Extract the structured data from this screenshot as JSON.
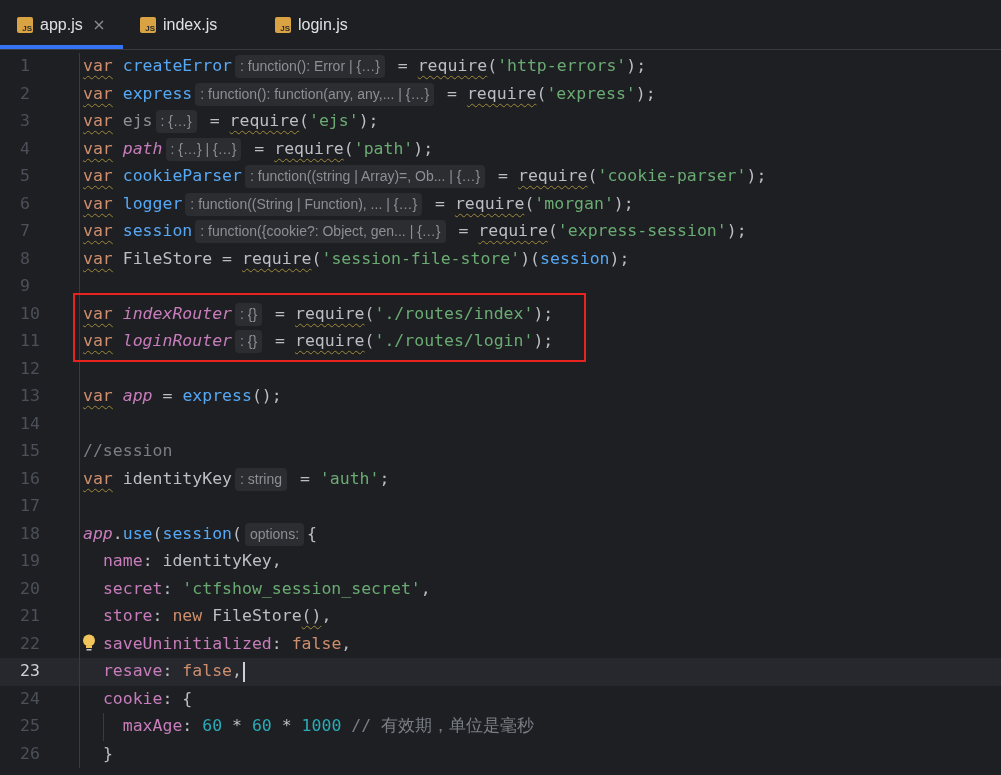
{
  "tabs": [
    {
      "label": "app.js",
      "icon": "JS",
      "selected": true,
      "closable": true
    },
    {
      "label": "index.js",
      "icon": "JS",
      "selected": false
    },
    {
      "label": "login.js",
      "icon": "JS",
      "selected": false
    }
  ],
  "lines": [
    {
      "number": "1",
      "tokens": [
        {
          "kind": "kw",
          "text": "var",
          "squiggle": true
        },
        {
          "kind": "fn",
          "text": " createError"
        },
        {
          "kind": "hint",
          "text": ": function(): Error | {…}"
        },
        {
          "kind": "plain",
          "text": " = "
        },
        {
          "kind": "plain",
          "text": "require",
          "squiggle": true
        },
        {
          "kind": "plain",
          "text": "("
        },
        {
          "kind": "str",
          "text": "'http-errors'"
        },
        {
          "kind": "plain",
          "text": ");"
        }
      ]
    },
    {
      "number": "2",
      "tokens": [
        {
          "kind": "kw",
          "text": "var",
          "squiggle": true
        },
        {
          "kind": "fn",
          "text": " express"
        },
        {
          "kind": "hint",
          "text": ": function(): function(any, any,... | {…}"
        },
        {
          "kind": "plain",
          "text": " = "
        },
        {
          "kind": "plain",
          "text": "require",
          "squiggle": true
        },
        {
          "kind": "plain",
          "text": "("
        },
        {
          "kind": "str",
          "text": "'express'"
        },
        {
          "kind": "plain",
          "text": ");"
        }
      ]
    },
    {
      "number": "3",
      "tokens": [
        {
          "kind": "kw",
          "text": "var",
          "squiggle": true
        },
        {
          "kind": "dim",
          "text": " ejs"
        },
        {
          "kind": "hint",
          "text": ": {…}"
        },
        {
          "kind": "plain",
          "text": " = "
        },
        {
          "kind": "plain",
          "text": "require",
          "squiggle": true
        },
        {
          "kind": "plain",
          "text": "("
        },
        {
          "kind": "str",
          "text": "'ejs'"
        },
        {
          "kind": "plain",
          "text": ");"
        }
      ]
    },
    {
      "number": "4",
      "tokens": [
        {
          "kind": "kw",
          "text": "var",
          "squiggle": true
        },
        {
          "kind": "param",
          "text": " path"
        },
        {
          "kind": "hint",
          "text": ": {…} | {…}"
        },
        {
          "kind": "plain",
          "text": " = "
        },
        {
          "kind": "plain",
          "text": "require",
          "squiggle": true
        },
        {
          "kind": "plain",
          "text": "("
        },
        {
          "kind": "str",
          "text": "'path'"
        },
        {
          "kind": "plain",
          "text": ");"
        }
      ]
    },
    {
      "number": "5",
      "tokens": [
        {
          "kind": "kw",
          "text": "var",
          "squiggle": true
        },
        {
          "kind": "fn",
          "text": " cookieParser"
        },
        {
          "kind": "hint",
          "text": ": function((string | Array)=, Ob... | {…}"
        },
        {
          "kind": "plain",
          "text": " = "
        },
        {
          "kind": "plain",
          "text": "require",
          "squiggle": true
        },
        {
          "kind": "plain",
          "text": "("
        },
        {
          "kind": "str",
          "text": "'cookie-parser'"
        },
        {
          "kind": "plain",
          "text": ");"
        }
      ]
    },
    {
      "number": "6",
      "tokens": [
        {
          "kind": "kw",
          "text": "var",
          "squiggle": true
        },
        {
          "kind": "fn",
          "text": " logger"
        },
        {
          "kind": "hint",
          "text": ": function((String | Function), ... | {…}"
        },
        {
          "kind": "plain",
          "text": " = "
        },
        {
          "kind": "plain",
          "text": "require",
          "squiggle": true
        },
        {
          "kind": "plain",
          "text": "("
        },
        {
          "kind": "str",
          "text": "'morgan'"
        },
        {
          "kind": "plain",
          "text": ");"
        }
      ]
    },
    {
      "number": "7",
      "tokens": [
        {
          "kind": "kw",
          "text": "var",
          "squiggle": true
        },
        {
          "kind": "fn",
          "text": " session"
        },
        {
          "kind": "hint",
          "text": ": function({cookie?: Object, gen... | {…}"
        },
        {
          "kind": "plain",
          "text": " = "
        },
        {
          "kind": "plain",
          "text": "require",
          "squiggle": true
        },
        {
          "kind": "plain",
          "text": "("
        },
        {
          "kind": "str",
          "text": "'express-session'"
        },
        {
          "kind": "plain",
          "text": ");"
        }
      ]
    },
    {
      "number": "8",
      "tokens": [
        {
          "kind": "kw",
          "text": "var",
          "squiggle": true
        },
        {
          "kind": "plain",
          "text": " FileStore = "
        },
        {
          "kind": "plain",
          "text": "require",
          "squiggle": true
        },
        {
          "kind": "plain",
          "text": "("
        },
        {
          "kind": "str",
          "text": "'session-file-store'"
        },
        {
          "kind": "plain",
          "text": ")("
        },
        {
          "kind": "fn",
          "text": "session"
        },
        {
          "kind": "plain",
          "text": ");"
        }
      ]
    },
    {
      "number": "9"
    },
    {
      "number": "10",
      "boxed": true,
      "tokens": [
        {
          "kind": "kw",
          "text": "var",
          "squiggle": true
        },
        {
          "kind": "param",
          "text": " indexRouter"
        },
        {
          "kind": "hint",
          "text": ": {}"
        },
        {
          "kind": "plain",
          "text": " = "
        },
        {
          "kind": "plain",
          "text": "require",
          "squiggle": true
        },
        {
          "kind": "plain",
          "text": "("
        },
        {
          "kind": "str",
          "text": "'./routes/index'"
        },
        {
          "kind": "plain",
          "text": ");"
        }
      ]
    },
    {
      "number": "11",
      "boxed": true,
      "tokens": [
        {
          "kind": "kw",
          "text": "var",
          "squiggle": true
        },
        {
          "kind": "param",
          "text": " loginRouter"
        },
        {
          "kind": "hint",
          "text": ": {}"
        },
        {
          "kind": "plain",
          "text": " = "
        },
        {
          "kind": "plain",
          "text": "require",
          "squiggle": true
        },
        {
          "kind": "plain",
          "text": "("
        },
        {
          "kind": "str",
          "text": "'./routes/login'"
        },
        {
          "kind": "plain",
          "text": ");"
        }
      ]
    },
    {
      "number": "12"
    },
    {
      "number": "13",
      "tokens": [
        {
          "kind": "kw",
          "text": "var",
          "squiggle": true
        },
        {
          "kind": "param",
          "text": " app"
        },
        {
          "kind": "plain",
          "text": " = "
        },
        {
          "kind": "fn",
          "text": "express"
        },
        {
          "kind": "plain",
          "text": "();"
        }
      ]
    },
    {
      "number": "14"
    },
    {
      "number": "15",
      "tokens": [
        {
          "kind": "comment",
          "text": "//session"
        }
      ]
    },
    {
      "number": "16",
      "tokens": [
        {
          "kind": "kw",
          "text": "var",
          "squiggle": true
        },
        {
          "kind": "plain",
          "text": " identityKey"
        },
        {
          "kind": "hint",
          "text": ": string"
        },
        {
          "kind": "plain",
          "text": " = "
        },
        {
          "kind": "str",
          "text": "'auth'"
        },
        {
          "kind": "plain",
          "text": ";"
        }
      ]
    },
    {
      "number": "17"
    },
    {
      "number": "18",
      "tokens": [
        {
          "kind": "param",
          "text": "app"
        },
        {
          "kind": "plain",
          "text": "."
        },
        {
          "kind": "fn",
          "text": "use"
        },
        {
          "kind": "plain",
          "text": "("
        },
        {
          "kind": "fn",
          "text": "session"
        },
        {
          "kind": "plain",
          "text": "("
        },
        {
          "kind": "hint",
          "text": "options:"
        },
        {
          "kind": "plain",
          "text": "{"
        }
      ]
    },
    {
      "number": "19",
      "tokens": [
        {
          "kind": "prop",
          "text": "  name"
        },
        {
          "kind": "plain",
          "text": ": identityKey,"
        }
      ]
    },
    {
      "number": "20",
      "tokens": [
        {
          "kind": "prop",
          "text": "  secret"
        },
        {
          "kind": "plain",
          "text": ": "
        },
        {
          "kind": "str",
          "text": "'ctfshow_session_secret'"
        },
        {
          "kind": "plain",
          "text": ","
        }
      ]
    },
    {
      "number": "21",
      "tokens": [
        {
          "kind": "prop",
          "text": "  store"
        },
        {
          "kind": "plain",
          "text": ": "
        },
        {
          "kind": "kw",
          "text": "new"
        },
        {
          "kind": "plain",
          "text": " FileStore"
        },
        {
          "kind": "plain",
          "text": "()",
          "squiggle": true
        },
        {
          "kind": "plain",
          "text": ","
        }
      ]
    },
    {
      "number": "22",
      "bulb": true,
      "tokens": [
        {
          "kind": "prop",
          "text": "  saveUninitialized"
        },
        {
          "kind": "plain",
          "text": ": "
        },
        {
          "kind": "kw",
          "text": "false"
        },
        {
          "kind": "plain",
          "text": ","
        }
      ]
    },
    {
      "number": "23",
      "current": true,
      "tokens": [
        {
          "kind": "prop",
          "text": "  resave"
        },
        {
          "kind": "plain",
          "text": ": "
        },
        {
          "kind": "kw",
          "text": "false"
        },
        {
          "kind": "plain",
          "text": ","
        }
      ]
    },
    {
      "number": "24",
      "tokens": [
        {
          "kind": "prop",
          "text": "  cookie"
        },
        {
          "kind": "plain",
          "text": ": {"
        }
      ]
    },
    {
      "number": "25",
      "guide": true,
      "tokens": [
        {
          "kind": "prop",
          "text": "    maxAge"
        },
        {
          "kind": "plain",
          "text": ": "
        },
        {
          "kind": "num",
          "text": "60"
        },
        {
          "kind": "plain",
          "text": " * "
        },
        {
          "kind": "num",
          "text": "60"
        },
        {
          "kind": "plain",
          "text": " * "
        },
        {
          "kind": "num",
          "text": "1000"
        },
        {
          "kind": "comment",
          "text": " // 有效期，单位是毫秒"
        }
      ]
    },
    {
      "number": "26",
      "tokens": [
        {
          "kind": "plain",
          "text": "  }"
        }
      ]
    }
  ]
}
